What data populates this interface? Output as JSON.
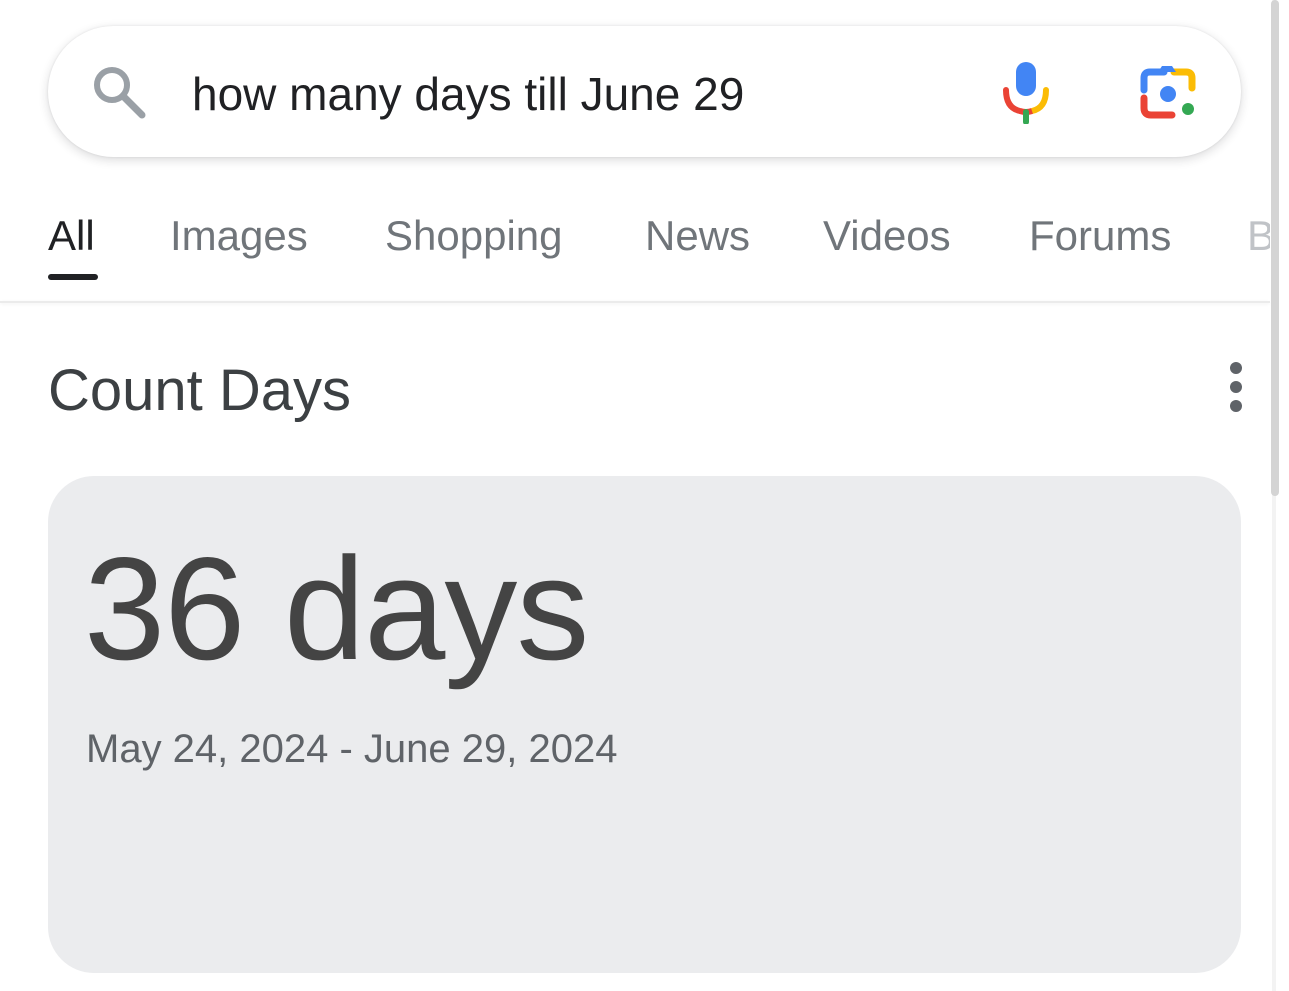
{
  "search": {
    "query": "how many days till June 29",
    "search_icon": "search-icon",
    "mic_icon": "mic-icon",
    "lens_icon": "camera-lens-icon"
  },
  "tabs": [
    {
      "label": "All",
      "active": true
    },
    {
      "label": "Images",
      "active": false
    },
    {
      "label": "Shopping",
      "active": false
    },
    {
      "label": "News",
      "active": false
    },
    {
      "label": "Videos",
      "active": false
    },
    {
      "label": "Forums",
      "active": false
    },
    {
      "label": "Bo",
      "active": false
    }
  ],
  "section": {
    "title": "Count Days",
    "more_icon": "more-vertical-icon"
  },
  "result": {
    "value": "36 days",
    "date_range": "May 24, 2024 - June 29, 2024"
  },
  "colors": {
    "google_blue": "#4285F4",
    "google_red": "#EA4335",
    "google_yellow": "#FBBC05",
    "google_green": "#34A853",
    "card_background": "#EBECEE",
    "text_primary": "#202124",
    "text_secondary": "#70757A"
  }
}
